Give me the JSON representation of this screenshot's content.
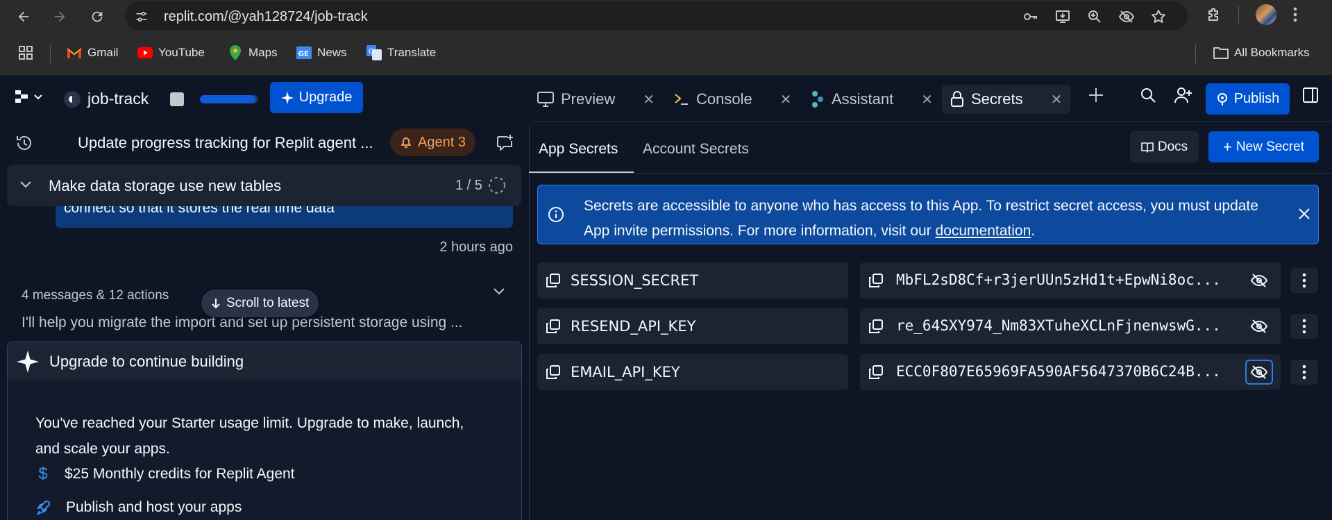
{
  "browser": {
    "url": "replit.com/@yah128724/job-track",
    "bookmarks": [
      {
        "label": "Gmail",
        "icon": "gmail-icon"
      },
      {
        "label": "YouTube",
        "icon": "youtube-icon"
      },
      {
        "label": "Maps",
        "icon": "maps-icon"
      },
      {
        "label": "News",
        "icon": "news-icon"
      },
      {
        "label": "Translate",
        "icon": "translate-icon"
      }
    ],
    "all_bookmarks": "All Bookmarks"
  },
  "header": {
    "project_name": "job-track",
    "upgrade_label": "Upgrade",
    "progress_fraction": 0.95,
    "tabs": [
      {
        "label": "Preview",
        "icon": "monitor-icon"
      },
      {
        "label": "Console",
        "icon": "terminal-icon"
      },
      {
        "label": "Assistant",
        "icon": "assistant-icon"
      },
      {
        "label": "Secrets",
        "icon": "lock-icon",
        "active": true
      }
    ],
    "publish_label": "Publish"
  },
  "left_panel": {
    "thread_title": "Update progress tracking for Replit agent ...",
    "agent_badge": "Agent 3",
    "task_label": "Make data storage use new tables",
    "task_count": "1 / 5",
    "user_message": "connect so that it stores the real time data",
    "timestamp": "2 hours ago",
    "messages_summary": "4 messages & 12 actions",
    "scroll_to_latest": "Scroll to latest",
    "preview_text": "I'll help you migrate the import and set up persistent storage using ...",
    "upgrade_card": {
      "title": "Upgrade to continue building",
      "body": "You've reached your Starter usage limit. Upgrade to make, launch, and scale your apps.",
      "perks": [
        {
          "icon": "dollar-icon",
          "label": "$25 Monthly credits for Replit Agent"
        },
        {
          "icon": "rocket-icon",
          "label": "Publish and host your apps"
        }
      ]
    }
  },
  "secrets_panel": {
    "tabs": [
      "App Secrets",
      "Account Secrets"
    ],
    "docs_label": "Docs",
    "new_secret_label": "New Secret",
    "info_text_main": "Secrets are accessible to anyone who has access to this App. To restrict secret access, you must update App invite permissions. For more information, visit our ",
    "info_link": "documentation",
    "info_text_end": ".",
    "secrets": [
      {
        "key": "SESSION_SECRET",
        "value": "MbFL2sD8Cf+r3jerUUn5zHd1t+EpwNi8oc..."
      },
      {
        "key": "RESEND_API_KEY",
        "value": "re_64SXY974_Nm83XTuheXCLnFjnenwswG..."
      },
      {
        "key": "EMAIL_API_KEY",
        "value": "ECC0F807E65969FA590AF5647370B6C24B..."
      }
    ]
  },
  "colors": {
    "bg": "#0e1525",
    "surface": "#1c2333",
    "accent": "#0053d0",
    "agent": "#f2a05f"
  }
}
